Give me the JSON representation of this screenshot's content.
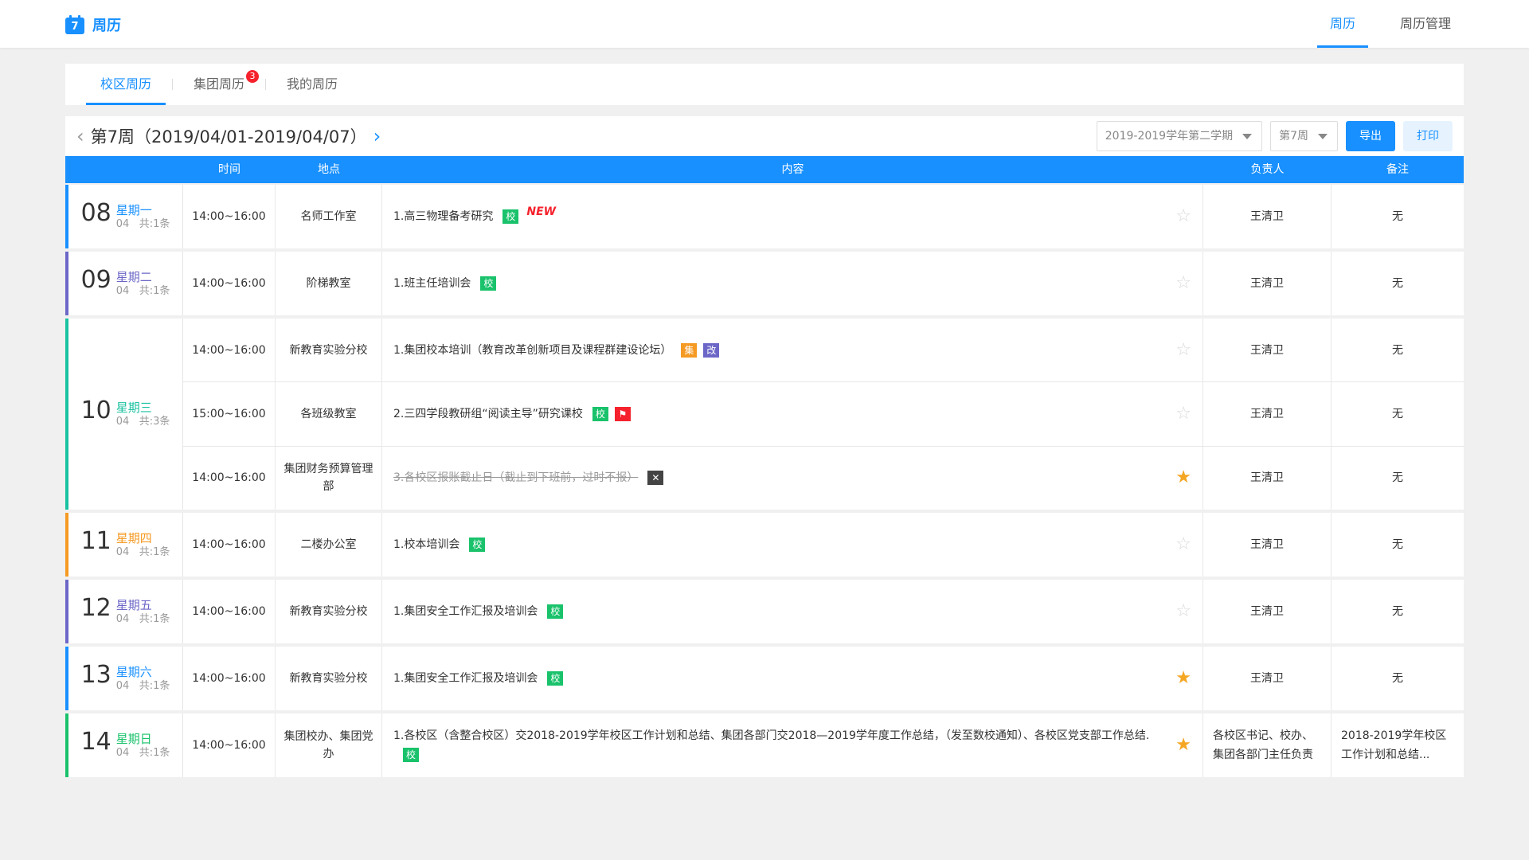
{
  "header": {
    "app_title": "周历",
    "nav": [
      {
        "label": "周历",
        "active": true
      },
      {
        "label": "周历管理",
        "active": false
      }
    ]
  },
  "tabs": [
    {
      "label": "校区周历",
      "active": true
    },
    {
      "label": "集团周历",
      "badge": "3"
    },
    {
      "label": "我的周历"
    }
  ],
  "week": {
    "title": "第7周（2019/04/01-2019/04/07）",
    "term_select": "2019-2019学年第二学期",
    "week_select": "第7周",
    "export_label": "导出",
    "print_label": "打印"
  },
  "columns": [
    "时间",
    "地点",
    "内容",
    "负责人",
    "备注"
  ],
  "colors": {
    "accent": "#1890ff",
    "tag_school": "#19c26b",
    "tag_group": "#f59a23",
    "tag_change": "#6c67c7",
    "tag_flag": "#f5222d",
    "star": "#f5a623"
  },
  "days": [
    {
      "date": "08",
      "weekday": "星期一",
      "month": "04",
      "count": "共:1条",
      "color": "#1890ff",
      "rows": [
        {
          "time": "14:00~16:00",
          "place": "名师工作室",
          "content": "1.高三物理备考研究",
          "tags": [
            {
              "text": "校",
              "type": "green"
            }
          ],
          "new": "NEW",
          "starred": false,
          "owner": "王清卫",
          "note": "无"
        }
      ]
    },
    {
      "date": "09",
      "weekday": "星期二",
      "month": "04",
      "count": "共:1条",
      "color": "#6c67c7",
      "rows": [
        {
          "time": "14:00~16:00",
          "place": "阶梯教室",
          "content": "1.班主任培训会",
          "tags": [
            {
              "text": "校",
              "type": "green"
            }
          ],
          "starred": false,
          "owner": "王清卫",
          "note": "无"
        }
      ]
    },
    {
      "date": "10",
      "weekday": "星期三",
      "month": "04",
      "count": "共:3条",
      "color": "#19c2a0",
      "rows": [
        {
          "time": "14:00~16:00",
          "place": "新教育实验分校",
          "content": "1.集团校本培训（教育改革创新项目及课程群建设论坛）",
          "tags": [
            {
              "text": "集",
              "type": "orange"
            },
            {
              "text": "改",
              "type": "purple"
            }
          ],
          "starred": false,
          "owner": "王清卫",
          "note": "无"
        },
        {
          "time": "15:00~16:00",
          "place": "各班级教室",
          "content": "2.三四学段教研组“阅读主导”研究课校",
          "tags": [
            {
              "text": "校",
              "type": "green"
            },
            {
              "text": "⚑",
              "type": "red"
            }
          ],
          "starred": false,
          "owner": "王清卫",
          "note": "无"
        },
        {
          "time": "14:00~16:00",
          "place": "集团财务预算管理部",
          "content": "3.各校区报账截止日（截止到下班前，过时不报）",
          "strike": true,
          "tags": [
            {
              "text": "✕",
              "type": "dark"
            }
          ],
          "starred": true,
          "owner": "王清卫",
          "note": "无"
        }
      ]
    },
    {
      "date": "11",
      "weekday": "星期四",
      "month": "04",
      "count": "共:1条",
      "color": "#f59a23",
      "rows": [
        {
          "time": "14:00~16:00",
          "place": "二楼办公室",
          "content": "1.校本培训会",
          "tags": [
            {
              "text": "校",
              "type": "green"
            }
          ],
          "starred": false,
          "owner": "王清卫",
          "note": "无"
        }
      ]
    },
    {
      "date": "12",
      "weekday": "星期五",
      "month": "04",
      "count": "共:1条",
      "color": "#6c67c7",
      "rows": [
        {
          "time": "14:00~16:00",
          "place": "新教育实验分校",
          "content": "1.集团安全工作汇报及培训会",
          "tags": [
            {
              "text": "校",
              "type": "green"
            }
          ],
          "starred": false,
          "owner": "王清卫",
          "note": "无"
        }
      ]
    },
    {
      "date": "13",
      "weekday": "星期六",
      "month": "04",
      "count": "共:1条",
      "color": "#1890ff",
      "rows": [
        {
          "time": "14:00~16:00",
          "place": "新教育实验分校",
          "content": "1.集团安全工作汇报及培训会",
          "tags": [
            {
              "text": "校",
              "type": "green"
            }
          ],
          "starred": true,
          "owner": "王清卫",
          "note": "无"
        }
      ]
    },
    {
      "date": "14",
      "weekday": "星期日",
      "month": "04",
      "count": "共:1条",
      "color": "#19c26b",
      "rows": [
        {
          "time": "14:00~16:00",
          "place": "集团校办、集团党办",
          "content": "1.各校区（含整合校区）交2018-2019学年校区工作计划和总结、集团各部门交2018—2019学年度工作总结，（发至数校通知）、各校区党支部工作总结.",
          "tags": [
            {
              "text": "校",
              "type": "green"
            }
          ],
          "starred": true,
          "owner": "各校区书记、校办、集团各部门主任负责",
          "note": "2018-2019学年校区工作计划和总结..."
        }
      ]
    }
  ]
}
